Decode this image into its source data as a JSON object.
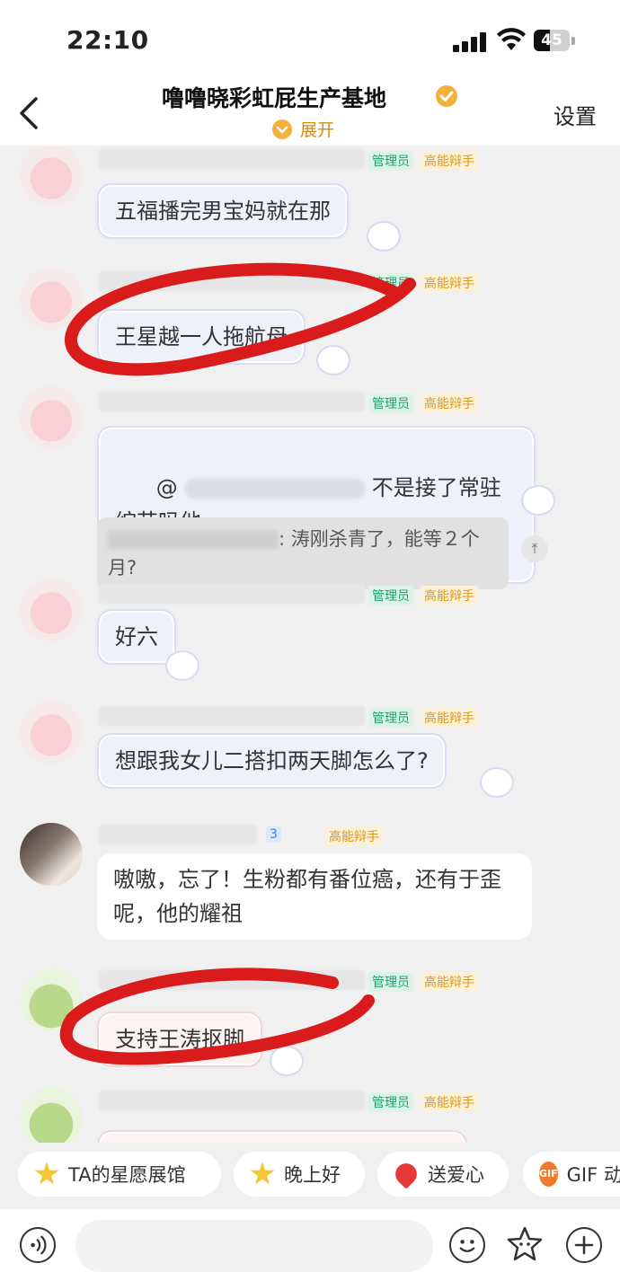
{
  "status_bar": {
    "time": "22:10",
    "battery": "45",
    "battery_fraction": 0.45
  },
  "header": {
    "back_icon": "chevron-left-icon",
    "title": "噜噜晓彩虹屁生产基地",
    "expand_label": "展开",
    "settings_label": "设置"
  },
  "badges": {
    "admin": "管理员",
    "debater": "高能辩手",
    "level": "3"
  },
  "messages": [
    {
      "text": "五福播完男宝妈就在那"
    },
    {
      "text": "王星越一人拖航母"
    },
    {
      "mention": "@",
      "text": "不是接了常驻综艺吗他",
      "quote": {
        "text": ": 涛刚杀青了，能等２个月?"
      }
    },
    {
      "text": "好六"
    },
    {
      "text": "想跟我女儿二搭扣两天脚怎么了?"
    },
    {
      "text": "嗷嗷，忘了！生粉都有番位癌，还有于歪呢，他的耀祖"
    },
    {
      "text": "支持王涛抠脚"
    }
  ],
  "quick_replies": [
    {
      "label": "TA的星愿展馆",
      "icon": "star-icon"
    },
    {
      "label": "晚上好",
      "icon": "star-face-icon"
    },
    {
      "label": "送爱心",
      "icon": "heart-icon"
    },
    {
      "label": "GIF 动",
      "icon": "gif-icon",
      "prefix": "GIF"
    }
  ],
  "input_bar": {
    "voice_icon": "voice-icon",
    "emoji_icon": "emoji-icon",
    "sticker_icon": "sticker-icon",
    "plus_icon": "plus-icon"
  }
}
